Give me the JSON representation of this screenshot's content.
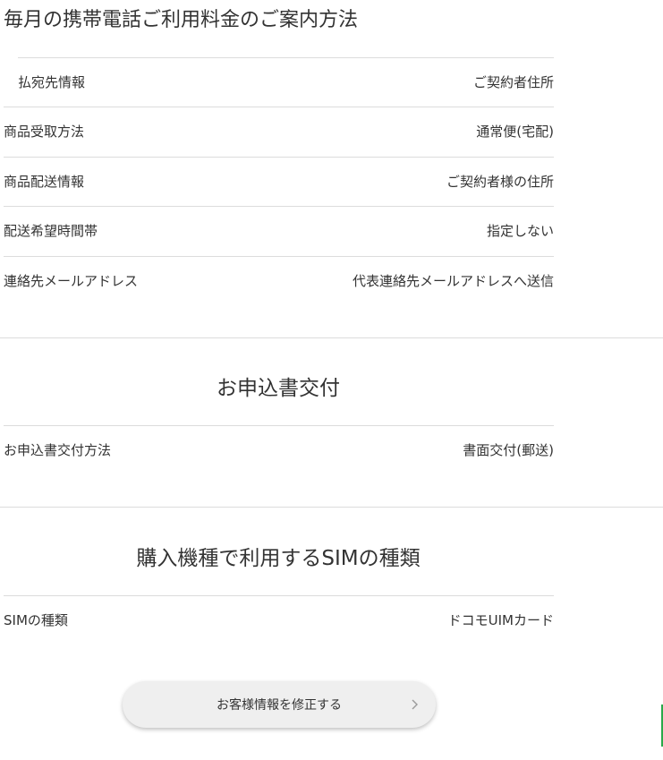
{
  "billing_notice": {
    "title": "毎月の携帯電話ご利用料金のご案内方法",
    "rows": [
      {
        "label": "払宛先情報",
        "value": "ご契約者住所"
      },
      {
        "label": "商品受取方法",
        "value": "通常便(宅配)"
      },
      {
        "label": "商品配送情報",
        "value": "ご契約者様の住所"
      },
      {
        "label": "配送希望時間帯",
        "value": "指定しない"
      },
      {
        "label": "連絡先メールアドレス",
        "value": "代表連絡先メールアドレスへ送信"
      }
    ]
  },
  "application_form": {
    "title": "お申込書交付",
    "rows": [
      {
        "label": "お申込書交付方法",
        "value": "書面交付(郵送)"
      }
    ]
  },
  "sim_type": {
    "title": "購入機種で利用するSIMの種類",
    "rows": [
      {
        "label": "SIMの種類",
        "value": "ドコモUIMカード"
      }
    ]
  },
  "edit_button": {
    "label": "お客様情報を修正する"
  },
  "colors": {
    "accent": "#2aa94a",
    "divider": "#dcdcdc",
    "text": "#333333",
    "button_bg": "#efefef"
  }
}
